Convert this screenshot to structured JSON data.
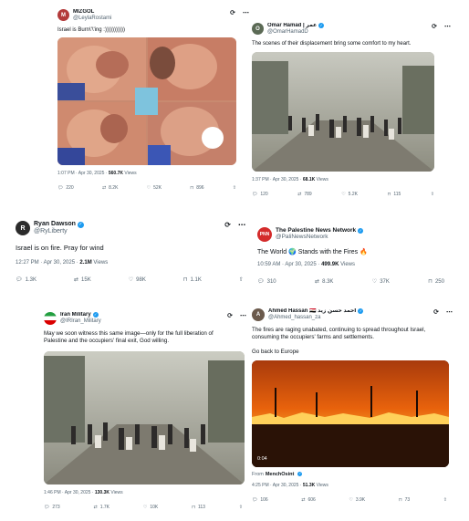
{
  "posts": [
    {
      "name": "MIZGOL",
      "handle": "@LeylaRostami",
      "text": "Israel is Burn\\'\\'ing :)))))))))))",
      "time": "1:07 PM · Apr 30, 2025 ·",
      "views": "560.7K",
      "views_label": "Views",
      "replies": "220",
      "reposts": "8.2K",
      "likes": "52K",
      "bookmarks": "896"
    },
    {
      "name": "Omar Hamad | عمر",
      "handle": "@OmarHamadD",
      "text": "The scenes of their displacement bring some comfort to my heart.",
      "time": "1:37 PM · Apr 30, 2025 ·",
      "views": "68.1K",
      "views_label": "Views",
      "replies": "120",
      "reposts": "789",
      "likes": "5.2K",
      "bookmarks": "115"
    },
    {
      "name": "Ryan Dawson",
      "handle": "@RyLiberty",
      "text": "Israel is on fire. Pray for wind",
      "time": "12:27 PM · Apr 30, 2025 ·",
      "views": "2.1M",
      "views_label": "Views",
      "replies": "1.3K",
      "reposts": "15K",
      "likes": "98K",
      "bookmarks": "1.1K"
    },
    {
      "name": "The Palestine News Network",
      "handle": "@PaliNewsNetwork",
      "text": "The World 🌍 Stands with the Fires 🔥",
      "time": "10:59 AM · Apr 30, 2025 ·",
      "views": "499.9K",
      "views_label": "Views",
      "replies": "310",
      "reposts": "8.3K",
      "likes": "37K",
      "bookmarks": "250",
      "avatar_text": "PNN"
    },
    {
      "name": "Iran Military",
      "handle": "@IRIran_Military",
      "text": "May we soon witness this same image—only for the full liberation of Palestine and the occupiers' final exit, God willing.",
      "time": "1:46 PM · Apr 30, 2025 ·",
      "views": "130.3K",
      "views_label": "Views",
      "replies": "273",
      "reposts": "1.7K",
      "likes": "10K",
      "bookmarks": "113"
    },
    {
      "name": "Ahmed Hassan 🇪🇬 احمد حسن زيد",
      "handle": "@Ahmed_hassan_za",
      "text": "The fires are raging unabated, continuing to spread throughout Israel, consuming the occupiers' farms and settlements.",
      "text2": "Go back to Europe",
      "video_time": "0:04",
      "from_label": "From",
      "from_name": "MenchOsint",
      "time": "4:25 PM · Apr 30, 2025 ·",
      "views": "51.3K",
      "views_label": "Views",
      "replies": "106",
      "reposts": "606",
      "likes": "3.9K",
      "bookmarks": "73"
    }
  ],
  "colors": {
    "verified": "#1d9bf0",
    "secondary_text": "#536471",
    "fire": "#e8620c"
  }
}
